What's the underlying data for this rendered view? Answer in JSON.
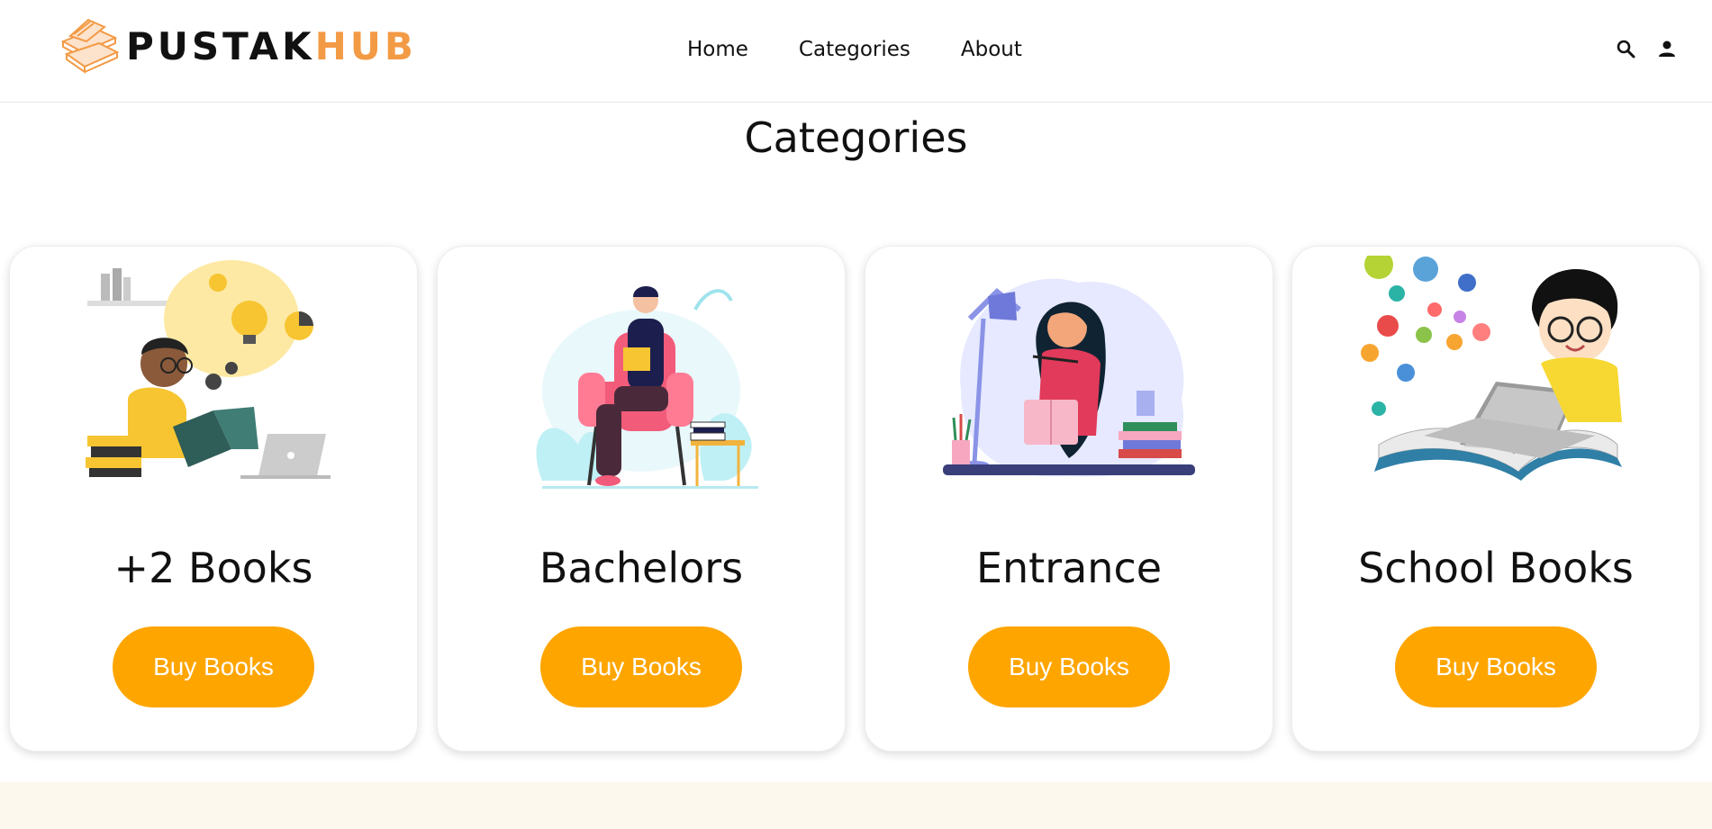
{
  "brand": {
    "part1": "PUSTAK",
    "part2": "HUB",
    "accent": "#f39a45"
  },
  "nav": {
    "links": [
      {
        "label": "Home"
      },
      {
        "label": "Categories"
      },
      {
        "label": "About"
      }
    ],
    "icons": [
      "search-icon",
      "user-icon"
    ]
  },
  "main": {
    "title": "Categories",
    "button_color": "#ffa500",
    "cards": [
      {
        "title": "+2 Books",
        "button": "Buy Books",
        "illustration": "student-reading-illustration"
      },
      {
        "title": "Bachelors",
        "button": "Buy Books",
        "illustration": "man-reading-armchair-illustration"
      },
      {
        "title": "Entrance",
        "button": "Buy Books",
        "illustration": "woman-studying-desk-illustration"
      },
      {
        "title": "School Books",
        "button": "Buy Books",
        "illustration": "boy-with-laptop-illustration"
      }
    ]
  },
  "footer": {
    "color": "#fdf8ee"
  }
}
